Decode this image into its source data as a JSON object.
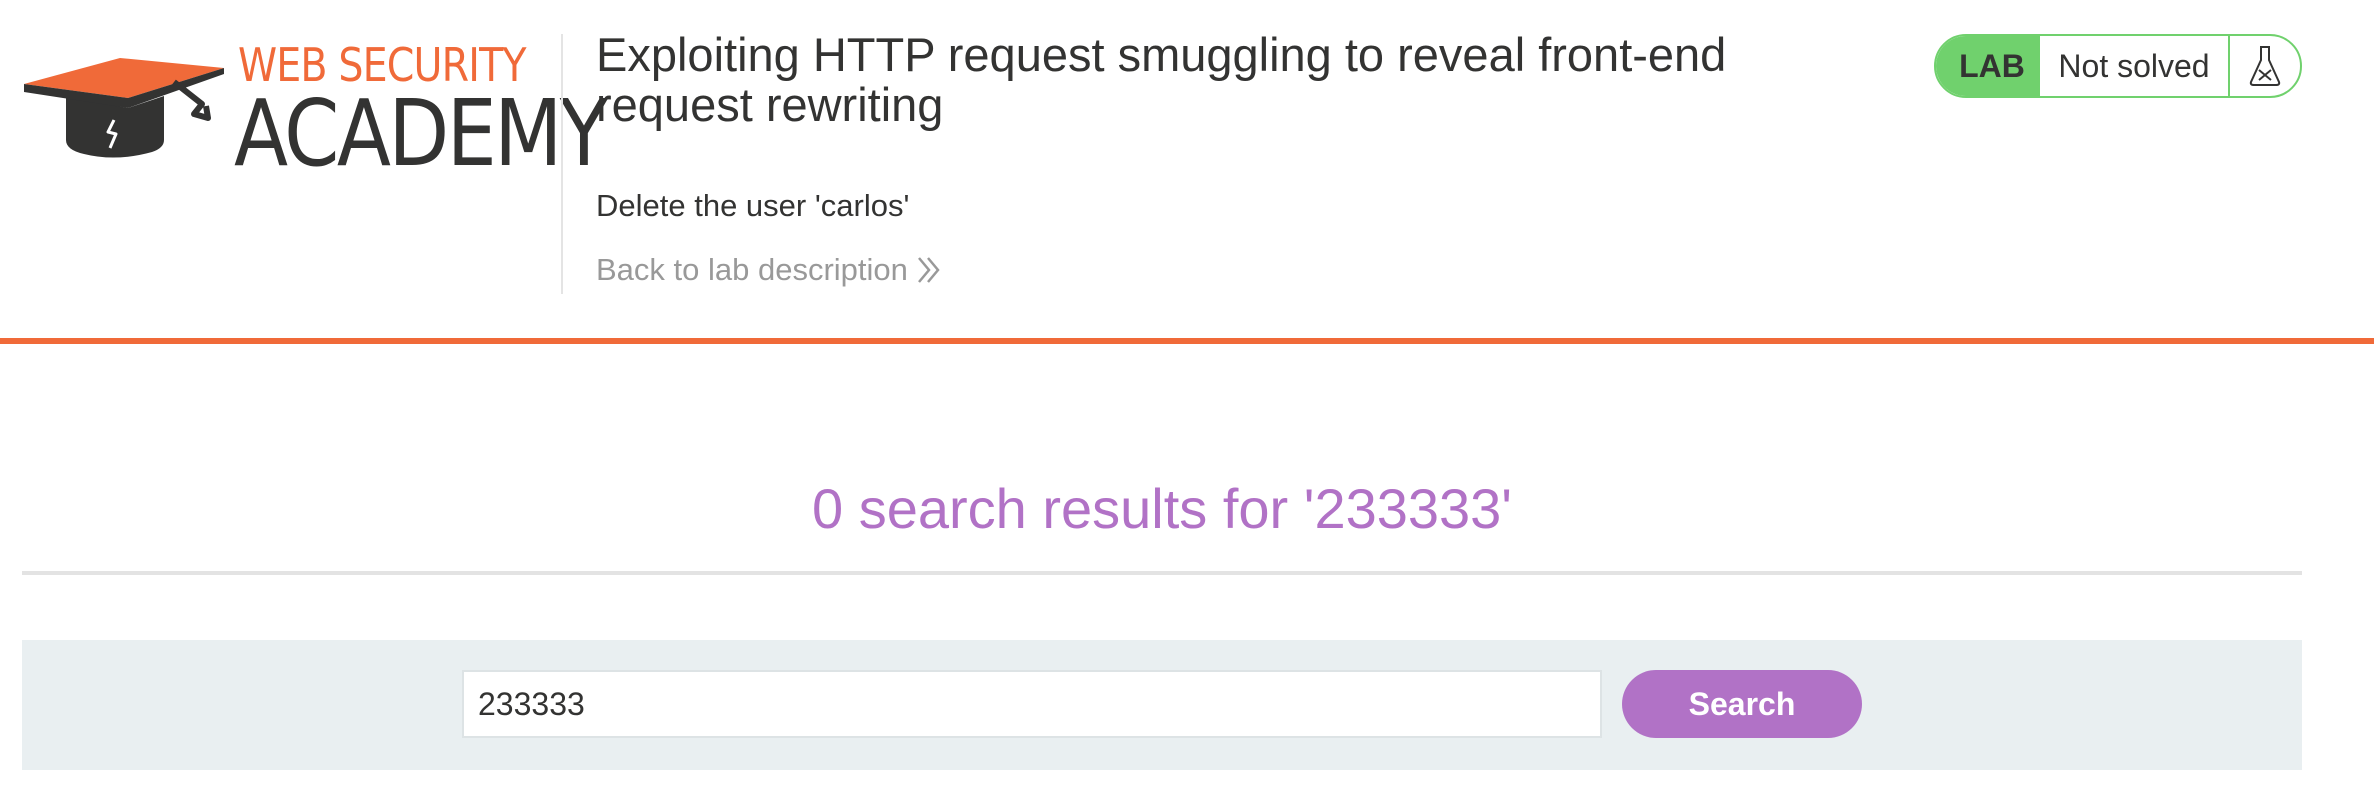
{
  "logo": {
    "line1": "WEB SECURITY",
    "line2": "ACADEMY",
    "icon": "graduation-cap-icon"
  },
  "lab": {
    "title": "Exploiting HTTP request smuggling to reveal front-end request rewriting",
    "objective": "Delete the user 'carlos'",
    "back_link": "Back to lab description",
    "back_icon": "double-chevron-right-icon",
    "badge_label": "LAB",
    "status": "Not solved",
    "status_icon": "flask-icon"
  },
  "results": {
    "heading": "0 search results for '233333'"
  },
  "search": {
    "value": "233333",
    "button_label": "Search"
  },
  "colors": {
    "accent_orange": "#f06a39",
    "accent_purple": "#b172c6",
    "status_green": "#70d16d"
  }
}
